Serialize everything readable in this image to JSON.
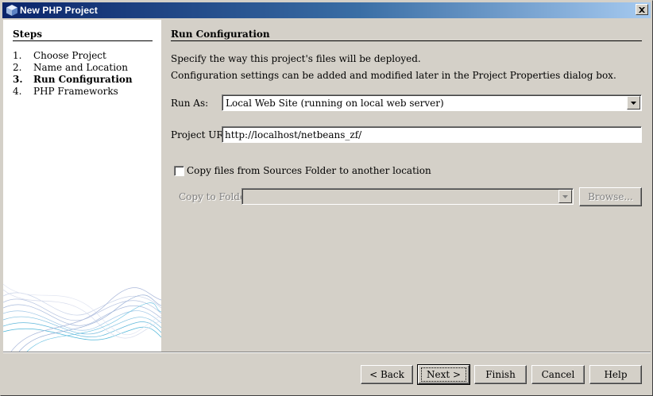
{
  "window": {
    "title": "New PHP Project",
    "close_symbol": "×"
  },
  "steps": {
    "title": "Steps",
    "items": [
      {
        "num": "1.",
        "label": "Choose Project"
      },
      {
        "num": "2.",
        "label": "Name and Location"
      },
      {
        "num": "3.",
        "label": "Run Configuration"
      },
      {
        "num": "4.",
        "label": "PHP Frameworks"
      }
    ]
  },
  "main": {
    "title": "Run Configuration",
    "desc1": "Specify the way this project's files will be deployed.",
    "desc2": "Configuration settings can be added and modified later in the Project Properties dialog box.",
    "run_as_label": "Run As:",
    "run_as_value": "Local Web Site (running on local web server)",
    "project_url_label": "Project URL:",
    "project_url_value": "http://localhost/netbeans_zf/",
    "copy_files_label": "Copy files from Sources Folder to another location",
    "copy_to_folder_label": "Copy to Folder:",
    "copy_to_folder_value": "",
    "browse_label": "Browse..."
  },
  "buttons": {
    "back": "< Back",
    "next": "Next >",
    "finish": "Finish",
    "cancel": "Cancel",
    "help": "Help"
  },
  "colors": {
    "titlebar_start": "#0a246a",
    "titlebar_end": "#a6caf0",
    "dialog_bg": "#d4d0c8",
    "wave_accent": "#4fb6d8"
  }
}
